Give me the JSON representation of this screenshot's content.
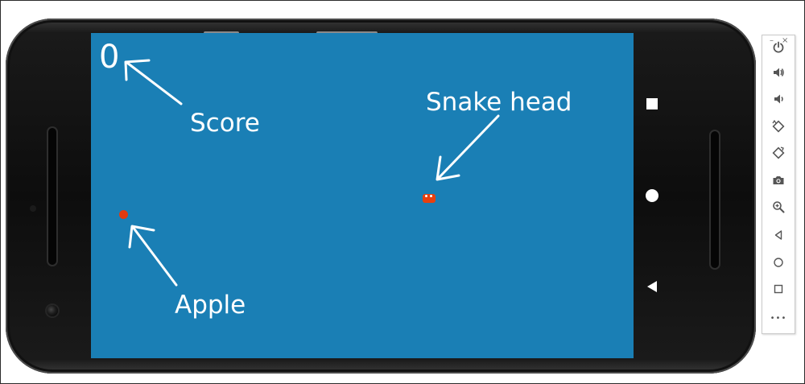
{
  "game": {
    "score": "0",
    "annotations": {
      "score": "Score",
      "apple": "Apple",
      "snake_head": "Snake head"
    },
    "colors": {
      "background": "#1a7fb5",
      "apple": "#e23a10",
      "snake": "#e8400f",
      "text": "#ffffff"
    }
  },
  "device": {
    "nav_buttons": [
      "recents-square",
      "home-circle",
      "back-triangle"
    ]
  },
  "emulator_toolbar": {
    "window_controls": {
      "minimize": "–",
      "close": "×"
    },
    "buttons": [
      "power-icon",
      "volume-up-icon",
      "volume-down-icon",
      "rotate-left-icon",
      "rotate-right-icon",
      "camera-icon",
      "zoom-icon",
      "back-icon",
      "home-icon",
      "overview-icon",
      "more-icon"
    ],
    "more_label": "•••"
  }
}
